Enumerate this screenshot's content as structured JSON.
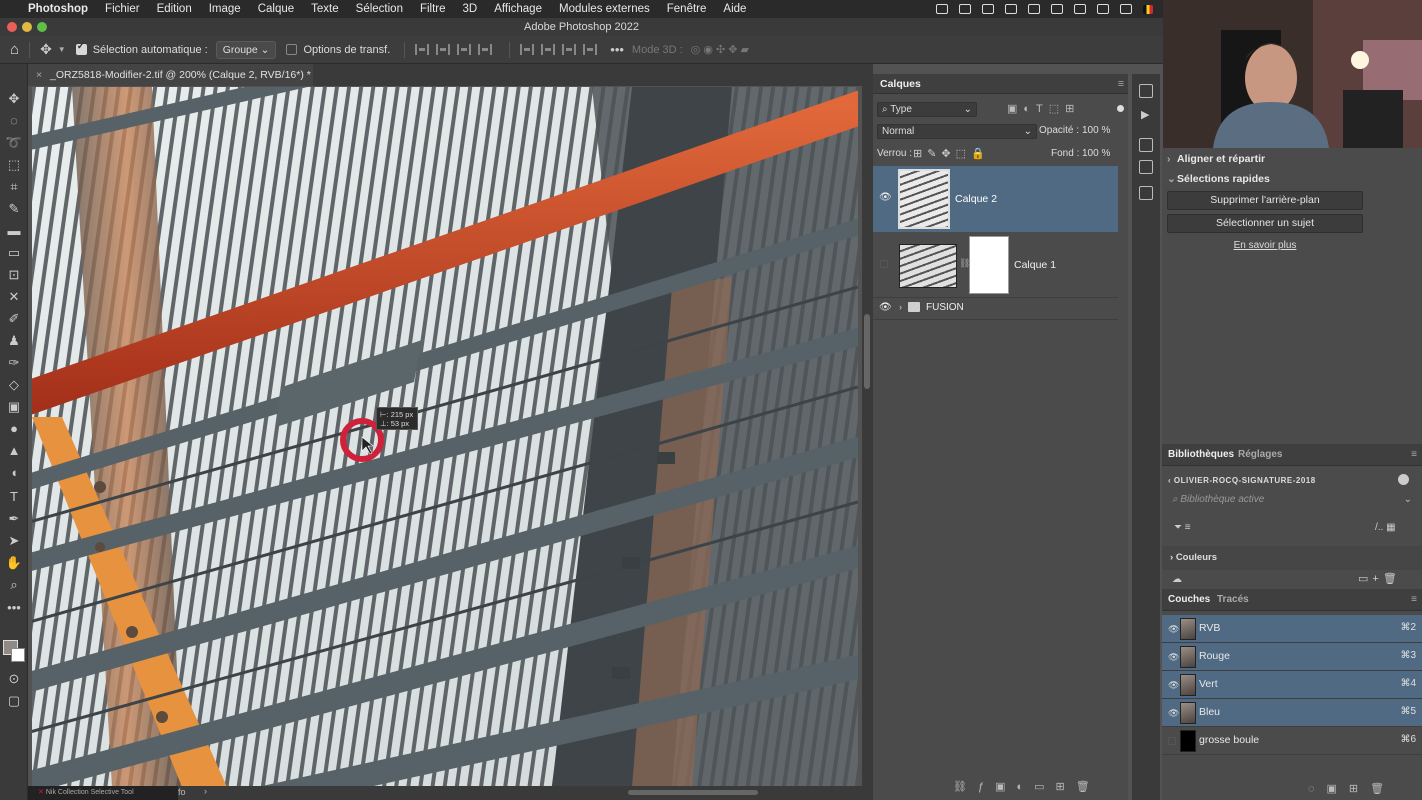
{
  "menubar": {
    "items": [
      "Photoshop",
      "Fichier",
      "Edition",
      "Image",
      "Calque",
      "Texte",
      "Sélection",
      "Filtre",
      "3D",
      "Affichage",
      "Modules externes",
      "Fenêtre",
      "Aide"
    ]
  },
  "window": {
    "title": "Adobe Photoshop 2022"
  },
  "options": {
    "auto_select_label": "Sélection automatique :",
    "auto_select_value": "Groupe",
    "transform_label": "Options de transf.",
    "mode3d_label": "Mode 3D :"
  },
  "document": {
    "tab_title": "_ORZ5818-Modifier-2.tif @ 200% (Calque 2, RVB/16*) *",
    "status_info": "fo",
    "tooltip_plugin": "Nik Collection Selective Tool"
  },
  "measure": {
    "width": "215 px",
    "height": "53 px"
  },
  "layers_panel": {
    "title": "Calques",
    "filter_type": "Type",
    "blend_mode": "Normal",
    "opacity_label": "Opacité :",
    "opacity_value": "100 %",
    "lock_label": "Verrou :",
    "fill_label": "Fond :",
    "fill_value": "100 %",
    "layers": [
      {
        "name": "Calque 2",
        "selected": true,
        "visible": true
      },
      {
        "name": "Calque 1",
        "selected": false,
        "visible": false
      },
      {
        "name": "FUSION",
        "selected": false,
        "visible": true,
        "group": true
      }
    ]
  },
  "right_panel": {
    "align_title": "Aligner et répartir",
    "quick_title": "Sélections rapides",
    "remove_bg": "Supprimer l'arrière-plan",
    "select_subject": "Sélectionner un sujet",
    "learn_more": "En savoir plus",
    "lib_tab": "Bibliothèques",
    "adj_tab": "Réglages",
    "library_name": "OLIVIER-ROCQ-SIGNATURE-2018",
    "library_search": "Bibliothèque active",
    "colors_section": "Couleurs",
    "channels_tab": "Couches",
    "paths_tab": "Tracés",
    "channels": [
      {
        "name": "RVB",
        "shortcut": "⌘2",
        "selected": true
      },
      {
        "name": "Rouge",
        "shortcut": "⌘3",
        "selected": true
      },
      {
        "name": "Vert",
        "shortcut": "⌘4",
        "selected": true
      },
      {
        "name": "Bleu",
        "shortcut": "⌘5",
        "selected": true
      },
      {
        "name": "grosse boule",
        "shortcut": "⌘6",
        "selected": false
      }
    ]
  },
  "colors": {
    "accent_selection": "#4f6a82",
    "cursor_ring": "#d0213a",
    "rail_orange": "#c9441e"
  }
}
